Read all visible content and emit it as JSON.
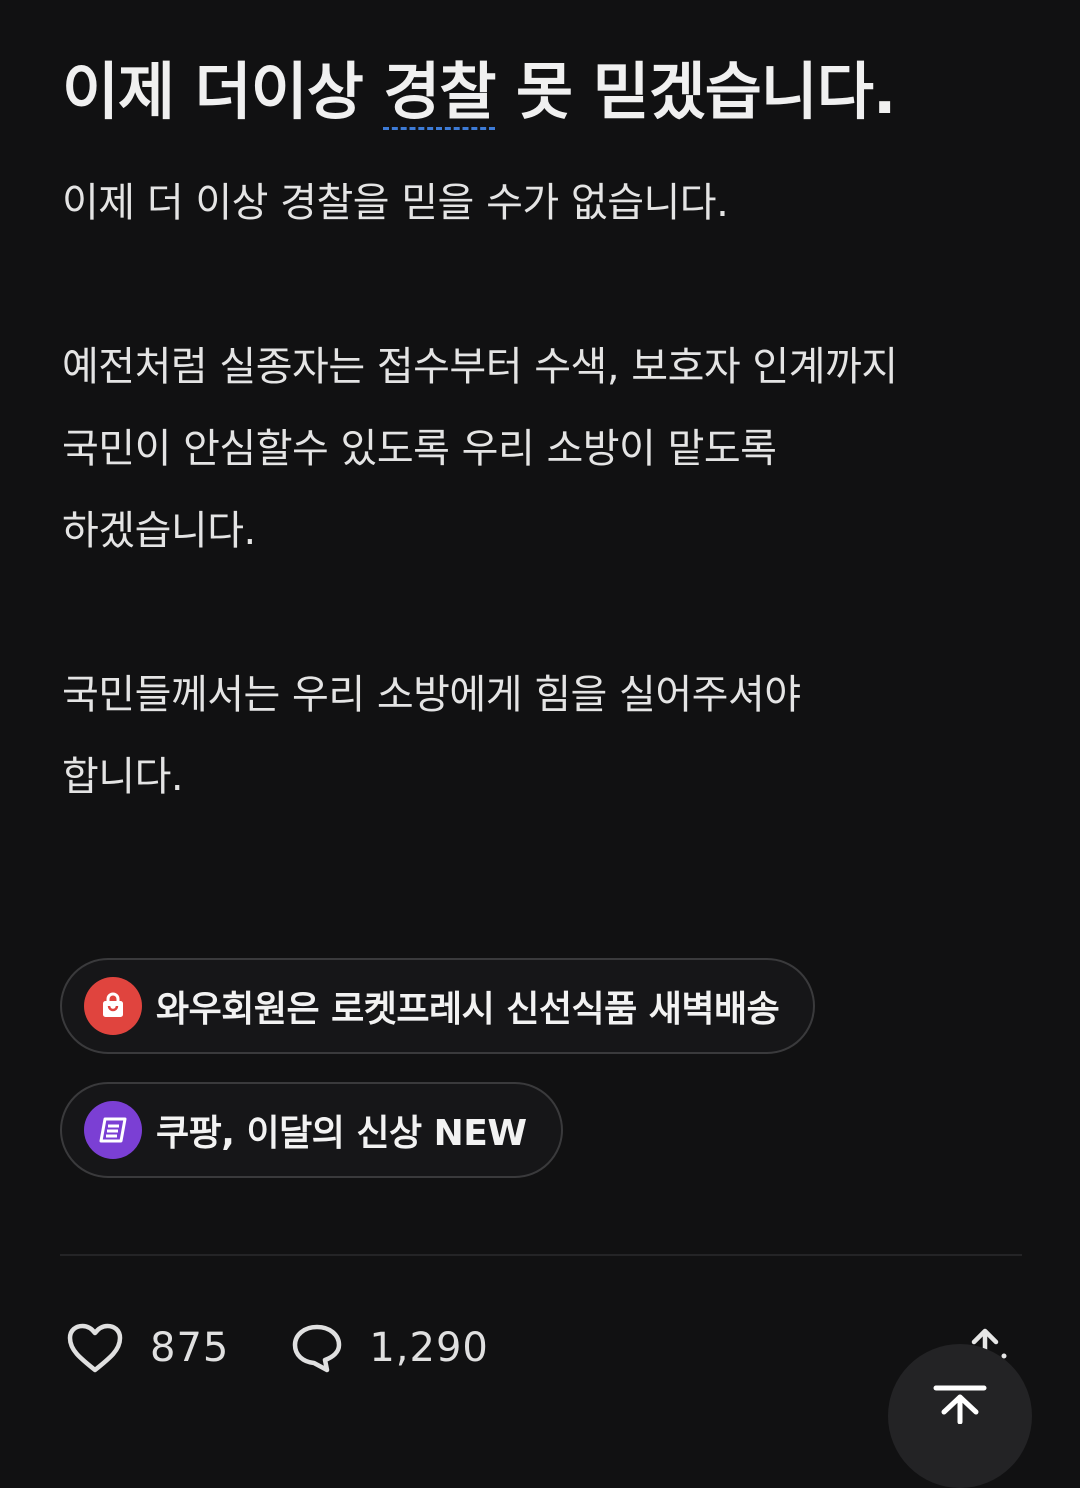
{
  "post": {
    "title_before": "이제 더이상 ",
    "title_keyword": "경찰",
    "title_after": " 못 믿겠습니다.",
    "paragraphs": [
      [
        "이제 더 이상 경찰을 믿을 수가 없습니다."
      ],
      [
        "예전처럼 실종자는 접수부터 수색, 보호자 인계까지",
        "국민이 안심할수 있도록 우리 소방이 맡도록",
        "하겠습니다."
      ],
      [
        "국민들께서는 우리 소방에게 힘을 실어주셔야",
        "합니다."
      ]
    ]
  },
  "promos": [
    {
      "label": "와우회원은 로켓프레시 신선식품 새벽배송",
      "icon": "shopping-bag-icon",
      "color": "#e0443e"
    },
    {
      "label": "쿠팡, 이달의 신상 NEW",
      "icon": "coupon-icon",
      "color": "#7b3fd4"
    }
  ],
  "actions": {
    "likes": "875",
    "comments": "1,290"
  },
  "colors": {
    "background": "#111112",
    "keyword_underline": "#3d7bd6"
  }
}
